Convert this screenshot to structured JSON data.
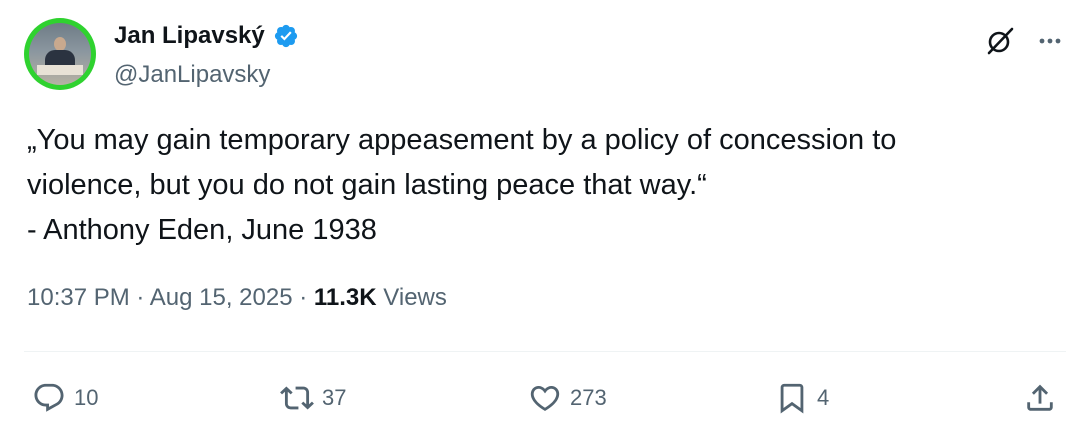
{
  "author": {
    "name": "Jan Lipavský",
    "handle": "@JanLipavsky",
    "verified": true,
    "avatar_ring_color": "#2fd22f"
  },
  "tweet": {
    "lines": [
      "„You may gain temporary appeasement by a policy of concession to",
      "violence, but you do not gain lasting peace that way.“",
      "- Anthony Eden, June 1938"
    ],
    "time": "10:37 PM",
    "separator": "·",
    "date": "Aug 15, 2025",
    "views_count": "11.3K",
    "views_label": "Views"
  },
  "actions": {
    "reply_count": "10",
    "retweet_count": "37",
    "like_count": "273",
    "bookmark_count": "4"
  },
  "icons": {
    "verified": "verified-badge-icon",
    "grok": "grok-icon",
    "more": "more-icon",
    "reply": "reply-icon",
    "retweet": "retweet-icon",
    "like": "heart-icon",
    "bookmark": "bookmark-icon",
    "share": "share-icon"
  },
  "colors": {
    "text_primary": "#0f1419",
    "text_secondary": "#536471",
    "verified_blue": "#1d9bf0",
    "divider": "#eff3f4"
  }
}
